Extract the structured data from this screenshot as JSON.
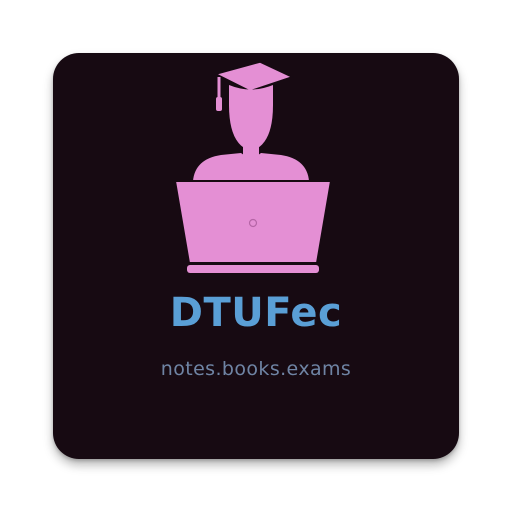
{
  "app_icon": {
    "brand_name": "DTUFec",
    "tagline": "notes.books.exams",
    "logo_icon": "graduate-with-laptop-icon",
    "colors": {
      "background": "#170a12",
      "logo": "#e48fd4",
      "brand_name": "#5a9fd6",
      "tagline": "#6f84a4"
    }
  }
}
